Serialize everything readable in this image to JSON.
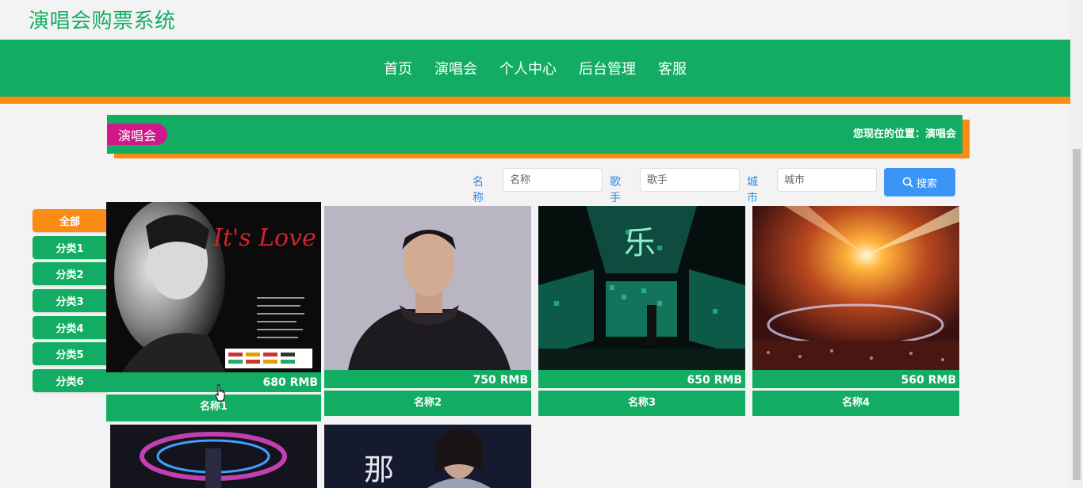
{
  "site": {
    "title": "演唱会购票系统"
  },
  "nav": [
    "首页",
    "演唱会",
    "个人中心",
    "后台管理",
    "客服"
  ],
  "section": {
    "title": "演唱会",
    "breadcrumb": "您现在的位置：演唱会"
  },
  "search": {
    "fields": [
      {
        "label": "名称",
        "placeholder": "名称"
      },
      {
        "label": "歌手",
        "placeholder": "歌手"
      },
      {
        "label": "城市",
        "placeholder": "城市"
      }
    ],
    "button": "搜索",
    "button_icon": "search-icon"
  },
  "categories": [
    "全部",
    "分类1",
    "分类2",
    "分类3",
    "分类4",
    "分类5",
    "分类6"
  ],
  "active_category": "全部",
  "cards": [
    {
      "name": "名称1",
      "price": "680 RMB"
    },
    {
      "name": "名称2",
      "price": "750 RMB"
    },
    {
      "name": "名称3",
      "price": "650 RMB"
    },
    {
      "name": "名称4",
      "price": "560 RMB"
    },
    {
      "name": "",
      "price": ""
    },
    {
      "name": "",
      "price": ""
    }
  ],
  "colors": {
    "brand_green": "#12ad63",
    "accent_orange": "#fb8b14",
    "pill_magenta": "#d0188b",
    "button_blue": "#3a95f7"
  }
}
